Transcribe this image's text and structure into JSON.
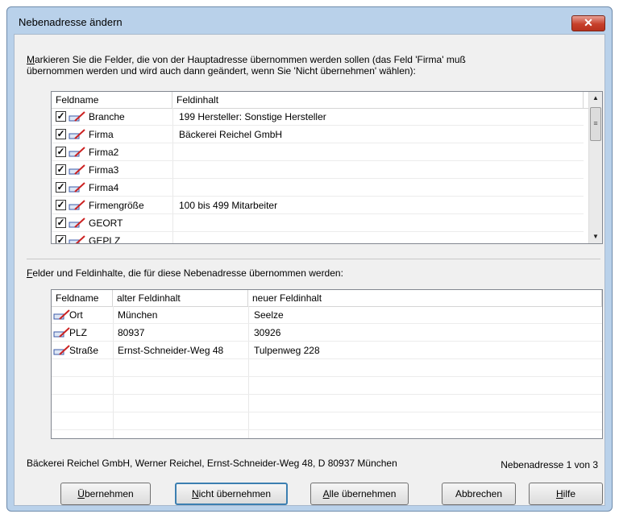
{
  "window": {
    "title": "Nebenadresse ändern",
    "close_glyph": "✕"
  },
  "instructions": {
    "first_letter": "M",
    "line1_rest": "arkieren Sie die Felder, die von der Hauptadresse übernommen werden sollen (das Feld 'Firma' muß",
    "line2": "übernommen werden und wird auch dann geändert, wenn Sie 'Nicht übernehmen' wählen):"
  },
  "list1": {
    "columns": [
      "Feldname",
      "Feldinhalt"
    ],
    "rows": [
      {
        "checked": true,
        "name": "Branche",
        "value": "199 Hersteller: Sonstige Hersteller"
      },
      {
        "checked": true,
        "name": "Firma",
        "value": "Bäckerei Reichel GmbH"
      },
      {
        "checked": true,
        "name": "Firma2",
        "value": ""
      },
      {
        "checked": true,
        "name": "Firma3",
        "value": ""
      },
      {
        "checked": true,
        "name": "Firma4",
        "value": ""
      },
      {
        "checked": true,
        "name": "Firmengröße",
        "value": "100 bis 499 Mitarbeiter"
      },
      {
        "checked": true,
        "name": "GEORT",
        "value": ""
      },
      {
        "checked": true,
        "name": "GEPLZ",
        "value": ""
      }
    ]
  },
  "section2": {
    "first_letter": "F",
    "rest": "elder und Feldinhalte, die für diese Nebenadresse übernommen werden:"
  },
  "list2": {
    "columns": [
      "Feldname",
      "alter Feldinhalt",
      "neuer Feldinhalt"
    ],
    "rows": [
      {
        "name": "Ort",
        "old": "München",
        "new": "Seelze"
      },
      {
        "name": "PLZ",
        "old": "80937",
        "new": "30926"
      },
      {
        "name": "Straße",
        "old": "Ernst-Schneider-Weg 48",
        "new": "Tulpenweg 228"
      }
    ]
  },
  "status": {
    "address": "Bäckerei Reichel GmbH, Werner Reichel, Ernst-Schneider-Weg 48, D 80937 München",
    "counter": "Nebenadresse 1 von 3"
  },
  "buttons": {
    "accept": {
      "u": "Ü",
      "rest": "bernehmen"
    },
    "reject": {
      "u": "N",
      "rest": "icht übernehmen"
    },
    "all": {
      "u": "A",
      "rest": "lle übernehmen"
    },
    "cancel": {
      "label": "Abbrechen"
    },
    "help": {
      "u": "H",
      "rest": "ilfe"
    }
  },
  "icons": {
    "checkbox": "checkbox-icon",
    "pen": "pen-icon"
  },
  "colors": {
    "title_bg": "#b9d1ea",
    "close": "#c7402b",
    "dialog_bg": "#f0f0f0"
  }
}
